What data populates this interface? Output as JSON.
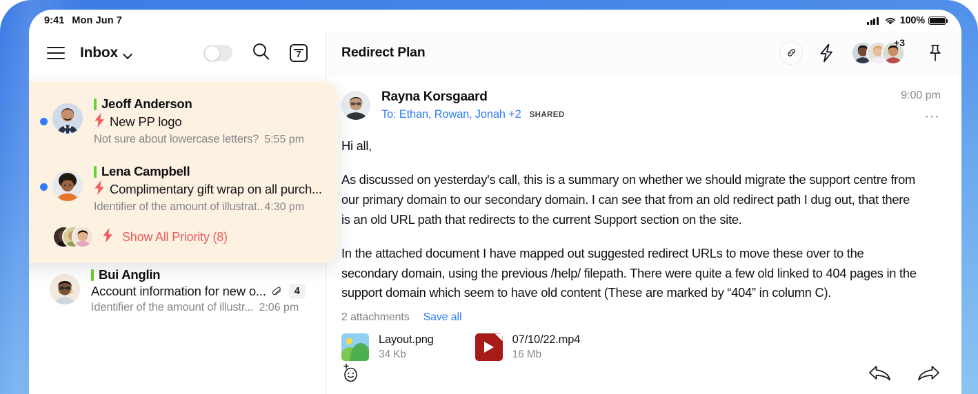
{
  "status_bar": {
    "time": "9:41",
    "date": "Mon Jun 7",
    "battery_percent": "100%",
    "signal_icon": "cellular-signal-icon",
    "wifi_icon": "wifi-icon",
    "battery_icon": "battery-icon"
  },
  "list_header": {
    "menu_icon": "hamburger-menu-icon",
    "title": "Inbox",
    "chevron_icon": "chevron-down-icon",
    "toggle_state": "off",
    "search_icon": "search-icon",
    "calendar_badge": "7"
  },
  "priority_card": {
    "items": [
      {
        "sender": "Jeoff Anderson",
        "subject": "New PP logo",
        "preview": "Not sure about lowercase letters?",
        "time": "5:55 pm",
        "unread": true,
        "priority": true
      },
      {
        "sender": "Lena Campbell",
        "subject": "Complimentary gift wrap on all purch...",
        "preview": "Identifier of the amount of illustrat..",
        "time": "4:30 pm",
        "unread": true,
        "priority": true
      }
    ],
    "show_all_label": "Show All Priority (8)",
    "show_all_color": "#ef5a5a"
  },
  "list_rows": [
    {
      "sender": "Bui Anglin",
      "subject": "Account information for new o...",
      "preview": "Identifier of the amount of illustr...",
      "time": "2:06 pm",
      "attachment_count": "4",
      "attachment_icon": "paperclip-icon"
    }
  ],
  "reading_pane": {
    "thread_title": "Redirect Plan",
    "link_icon": "link-icon",
    "bolt_icon": "lightning-bolt-icon",
    "participants_overflow": "+3",
    "pin_icon": "pin-icon",
    "message": {
      "from": "Rayna Korsgaard",
      "to": "To: Ethan, Rowan, Jonah +2",
      "shared_tag": "SHARED",
      "time": "9:00 pm",
      "more_icon": "more-options-icon",
      "body": [
        "Hi all,",
        "As discussed on yesterday's call, this is a summary on whether we should migrate the support centre from our primary domain to our secondary domain. I can see that from an old redirect path I dug out, that there is an old URL path that redirects to the current Support section on the site.",
        "In the attached document I have mapped out suggested redirect URLs to move these over to the secondary domain, using the previous /help/ filepath. There were quite a few old linked to 404 pages in the support domain which seem to have old content (These are marked by “404” in column C)."
      ]
    },
    "attachments": {
      "count_label": "2 attachments",
      "save_all_label": "Save all",
      "files": [
        {
          "name": "Layout.png",
          "size": "34 Kb",
          "kind": "image"
        },
        {
          "name": "07/10/22.mp4",
          "size": "16 Mb",
          "kind": "video"
        }
      ]
    },
    "bottom_bar": {
      "react_icon": "add-reaction-icon",
      "reply_icon": "reply-arrow-icon",
      "forward_icon": "forward-arrow-icon"
    }
  },
  "colors": {
    "frame_blue_top": "#3b7ae4",
    "frame_blue_bottom": "#8cc3f2",
    "priority_card_bg": "#fdf2e2",
    "accent_blue": "#2f7cf6",
    "priority_green": "#63d237",
    "priority_red": "#ef5a5a",
    "video_red": "#a81a18"
  }
}
